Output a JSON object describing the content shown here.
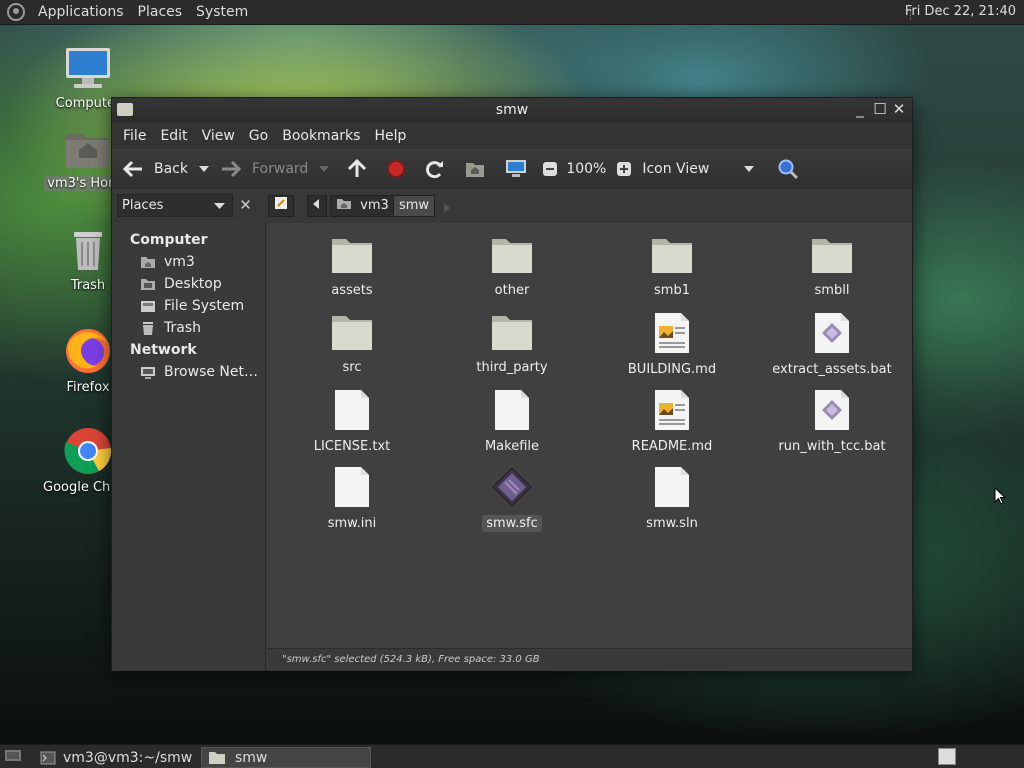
{
  "top_panel": {
    "menus": [
      "Applications",
      "Places",
      "System"
    ],
    "clock": "Fri Dec 22, 21:40"
  },
  "desktop": {
    "icons": [
      {
        "label": "Computer",
        "icon": "computer-icon"
      },
      {
        "label": "vm3's Home",
        "icon": "home-folder-icon"
      },
      {
        "label": "Trash",
        "icon": "trash-icon"
      },
      {
        "label": "Firefox",
        "icon": "firefox-icon"
      },
      {
        "label": "Google Chrome",
        "icon": "chrome-icon"
      }
    ]
  },
  "window": {
    "title": "smw",
    "menubar": [
      "File",
      "Edit",
      "View",
      "Go",
      "Bookmarks",
      "Help"
    ],
    "toolbar": {
      "back": "Back",
      "forward": "Forward",
      "zoom": "100%",
      "view_mode": "Icon View"
    },
    "sidebar": {
      "header": "Places",
      "sections": [
        {
          "title": "Computer",
          "items": [
            {
              "label": "vm3",
              "icon": "home-folder-icon"
            },
            {
              "label": "Desktop",
              "icon": "desktop-folder-icon"
            },
            {
              "label": "File System",
              "icon": "drive-icon"
            },
            {
              "label": "Trash",
              "icon": "trash-icon"
            }
          ]
        },
        {
          "title": "Network",
          "items": [
            {
              "label": "Browse Net…",
              "icon": "network-icon"
            }
          ]
        }
      ]
    },
    "breadcrumbs": [
      "vm3",
      "smw"
    ],
    "files": [
      {
        "name": "assets",
        "type": "folder"
      },
      {
        "name": "other",
        "type": "folder"
      },
      {
        "name": "smb1",
        "type": "folder"
      },
      {
        "name": "smbll",
        "type": "folder"
      },
      {
        "name": "src",
        "type": "folder"
      },
      {
        "name": "third_party",
        "type": "folder"
      },
      {
        "name": "BUILDING.md",
        "type": "image-doc"
      },
      {
        "name": "extract_assets.bat",
        "type": "script"
      },
      {
        "name": "LICENSE.txt",
        "type": "text"
      },
      {
        "name": "Makefile",
        "type": "text"
      },
      {
        "name": "README.md",
        "type": "image-doc"
      },
      {
        "name": "run_with_tcc.bat",
        "type": "script"
      },
      {
        "name": "smw.ini",
        "type": "text"
      },
      {
        "name": "smw.sfc",
        "type": "rom",
        "selected": true
      },
      {
        "name": "smw.sln",
        "type": "text"
      }
    ],
    "status": "\"smw.sfc\" selected (524.3 kB), Free space: 33.0 GB"
  },
  "taskbar": {
    "tasks": [
      {
        "label": "vm3@vm3:~/smw",
        "active": false
      },
      {
        "label": "smw",
        "active": true
      }
    ]
  }
}
